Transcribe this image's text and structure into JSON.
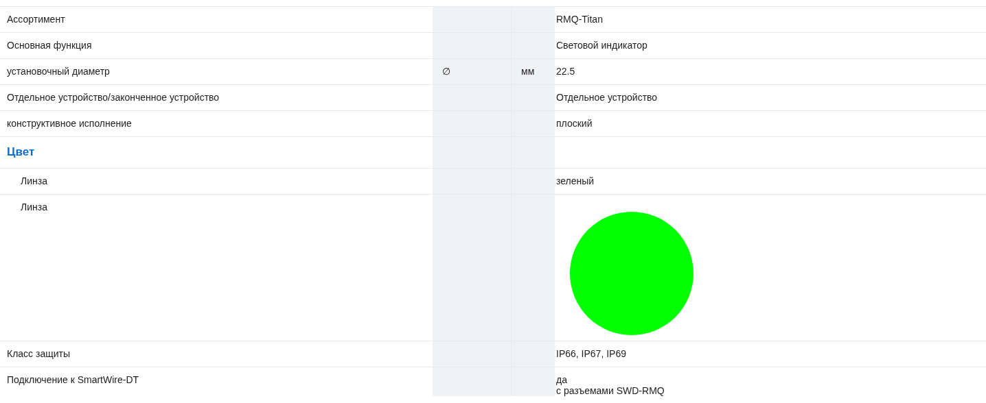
{
  "rows": [
    {
      "kind": "row",
      "label": "Ассортимент",
      "value": [
        "RMQ-Titan"
      ]
    },
    {
      "kind": "row",
      "label": "Основная функция",
      "value": [
        "Световой индикатор"
      ]
    },
    {
      "kind": "row",
      "label": "установочный диаметр",
      "symbol": "∅",
      "unit": "мм",
      "value": [
        "22.5"
      ]
    },
    {
      "kind": "row",
      "label": "Отдельное устройство/законченное устройство",
      "value": [
        "Отдельное устройство"
      ]
    },
    {
      "kind": "row",
      "label": "конструктивное исполнение",
      "value": [
        "плоский"
      ]
    },
    {
      "kind": "heading",
      "label": "Цвет",
      "children": [
        {
          "kind": "row",
          "label": "Линза",
          "value": [
            "зеленый"
          ]
        },
        {
          "kind": "swatch",
          "label": "Линза",
          "color": "#00ff00"
        }
      ]
    },
    {
      "kind": "row",
      "label": "Класс защиты",
      "value": [
        "IP66, IP67, IP69"
      ]
    },
    {
      "kind": "row",
      "label": "Подключение к SmartWire-DT",
      "value": [
        "да",
        "с разъемами SWD-RMQ"
      ]
    }
  ]
}
